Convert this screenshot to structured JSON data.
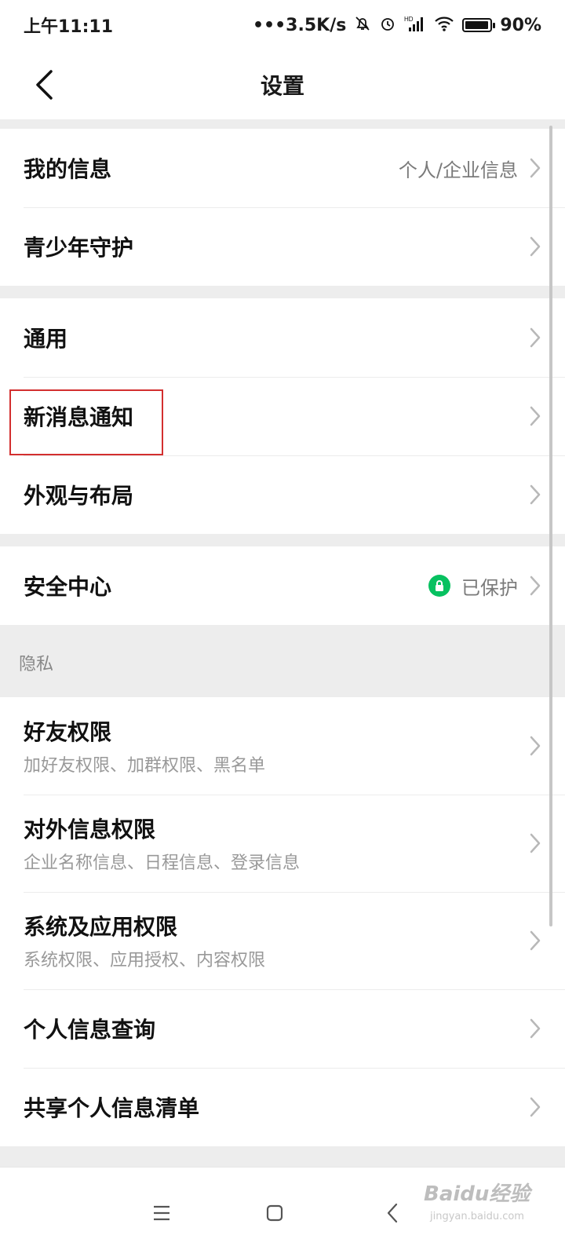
{
  "status_bar": {
    "time": "上午11:11",
    "network_speed": "•••3.5K/s",
    "signal_tag": "HD",
    "battery_percent": "90%"
  },
  "header": {
    "title": "设置",
    "back_icon": "chevron-left-icon"
  },
  "groups": {
    "account": [
      {
        "label": "我的信息",
        "value": "个人/企业信息"
      },
      {
        "label": "青少年守护"
      }
    ],
    "general": [
      {
        "label": "通用"
      },
      {
        "label": "新消息通知"
      },
      {
        "label": "外观与布局"
      }
    ],
    "security": [
      {
        "label": "安全中心",
        "value": "已保护",
        "badge_icon": "lock-icon"
      }
    ]
  },
  "privacy": {
    "header": "隐私",
    "items": [
      {
        "label": "好友权限",
        "sub": "加好友权限、加群权限、黑名单"
      },
      {
        "label": "对外信息权限",
        "sub": "企业名称信息、日程信息、登录信息"
      },
      {
        "label": "系统及应用权限",
        "sub": "系统权限、应用授权、内容权限"
      },
      {
        "label": "个人信息查询"
      },
      {
        "label": "共享个人信息清单"
      }
    ]
  },
  "watermark": {
    "text": "Baidu经验",
    "sub": "jingyan.baidu.com"
  },
  "colors": {
    "accent_green": "#07c160",
    "highlight_red": "#d32f2f",
    "background": "#ededed"
  }
}
